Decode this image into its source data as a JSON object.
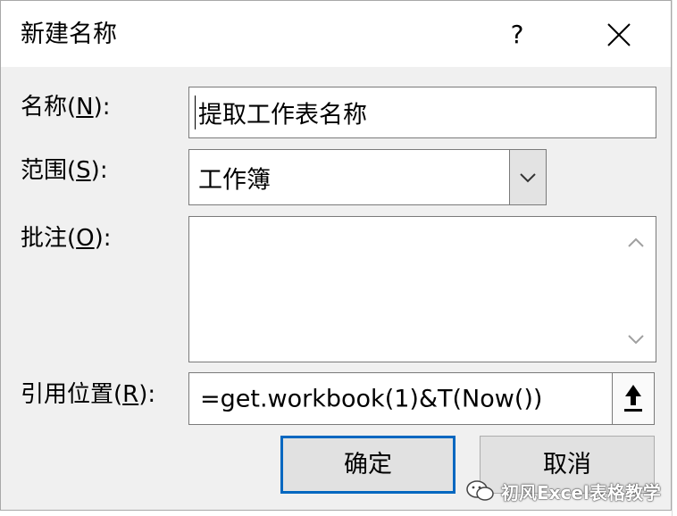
{
  "dialog": {
    "title": "新建名称",
    "help_label": "?",
    "close_label": "close"
  },
  "fields": {
    "name_label": "名称(",
    "name_key": "N",
    "name_label_end": "):",
    "name_value": "提取工作表名称",
    "scope_label": "范围(",
    "scope_key": "S",
    "scope_label_end": "):",
    "scope_value": "工作簿",
    "comment_label": "批注(",
    "comment_key": "O",
    "comment_label_end": "):",
    "comment_value": "",
    "ref_label": "引用位置(",
    "ref_key": "R",
    "ref_label_end": "):",
    "ref_value": "=get.workbook(1)&T(Now())"
  },
  "buttons": {
    "ok": "确定",
    "cancel": "取消"
  },
  "watermark": {
    "text": "初风Excel表格教学"
  },
  "icons": {
    "dropdown": "chevron-down-icon",
    "scroll_up": "chevron-up-icon",
    "scroll_down": "chevron-down-icon",
    "collapse": "collapse-dialog-arrow-icon",
    "close": "close-icon",
    "logo": "wechat-logo-icon"
  },
  "colors": {
    "dialog_bg": "#f0f0f0",
    "default_button_border": "#0067c0"
  }
}
